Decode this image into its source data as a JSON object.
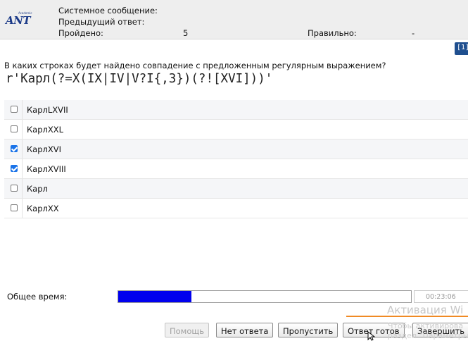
{
  "header": {
    "logo_text": "ANT",
    "logo_small": "Academic",
    "system_message_label": "Системное сообщение:",
    "previous_answer_label": "Предыдущий ответ:",
    "passed_label": "Пройдено:",
    "passed_value": "5",
    "correct_label": "Правильно:",
    "correct_value": "-"
  },
  "question_badge": "[1]",
  "question": {
    "text": "В каких строках будет найдено совпадение с предложенным регулярным выражением?",
    "regex": "r'Карл(?=X(IX|IV|V?I{,3})(?![XVI]))'"
  },
  "options": [
    {
      "label": "КарлLXVII",
      "checked": false
    },
    {
      "label": "КарлXXL",
      "checked": false
    },
    {
      "label": "КарлXVI",
      "checked": true
    },
    {
      "label": "КарлXVIII",
      "checked": true
    },
    {
      "label": "Карл",
      "checked": false
    },
    {
      "label": "КарлXX",
      "checked": false
    }
  ],
  "timer": {
    "label": "Общее время:",
    "elapsed": "00:23:06",
    "progress_fraction": 0.25
  },
  "watermark": {
    "line1": "Активация Wi",
    "line2": "Чтобы активирова",
    "line3": "раздел \"Параметры"
  },
  "buttons": {
    "help": "Помощь",
    "no_answer": "Нет ответа",
    "skip": "Пропустить",
    "answer_ready": "Ответ готов",
    "finish": "Завершить"
  },
  "colors": {
    "progress_fill": "#0000ee",
    "checkbox_checked": "#1a73e8",
    "badge": "#1f4f8f",
    "logo": "#1b3a88"
  }
}
